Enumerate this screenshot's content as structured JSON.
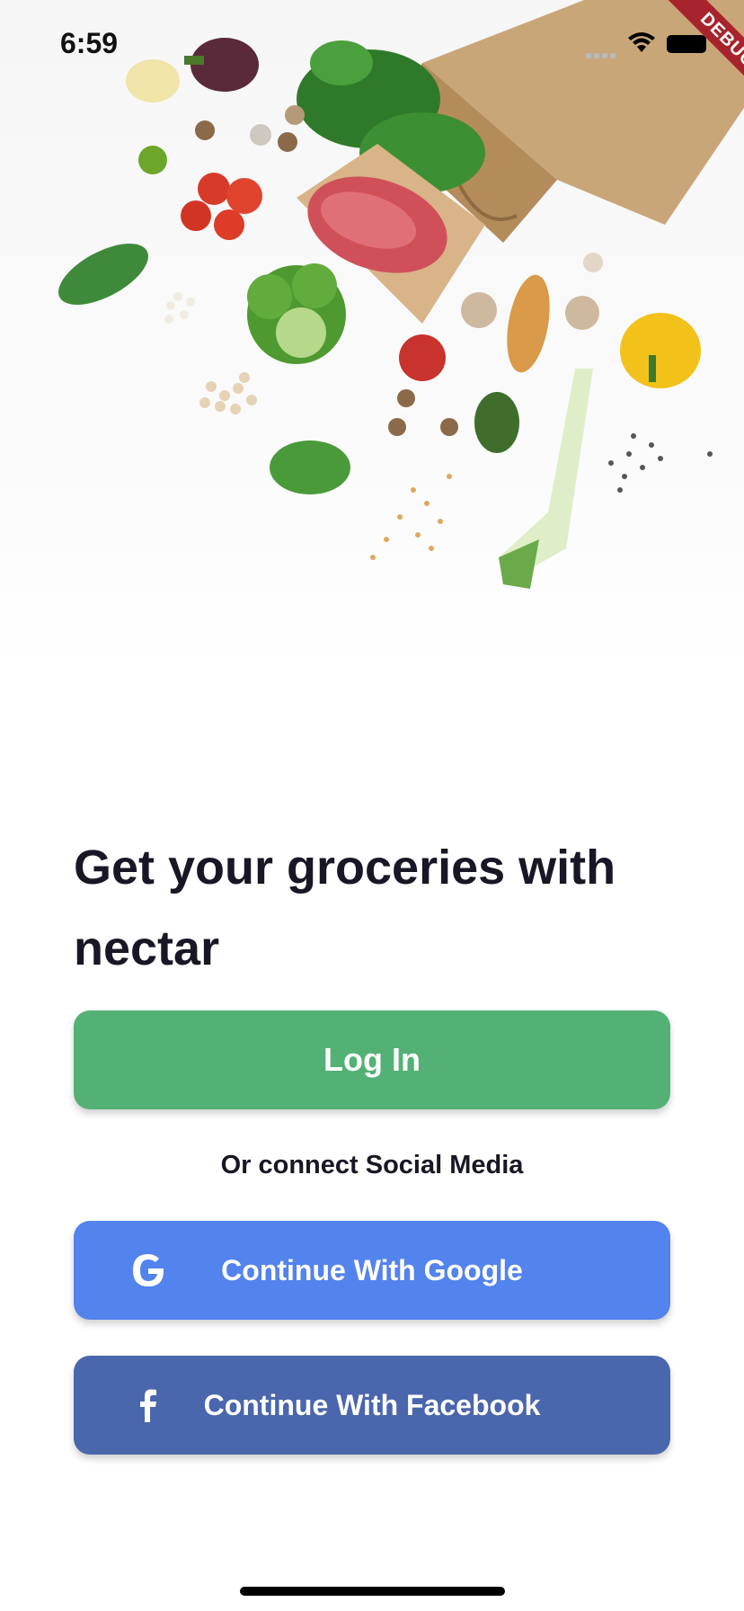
{
  "status_bar": {
    "time": "6:59",
    "debug_banner": "DEBUG"
  },
  "hero": {
    "image": "groceries-illustration"
  },
  "onboarding": {
    "headline": "Get your groceries with nectar",
    "login_button": "Log In",
    "social_prompt": "Or connect Social Media",
    "google_button": "Continue With Google",
    "facebook_button": "Continue With Facebook"
  },
  "colors": {
    "login": "#53b175",
    "google": "#5383ec",
    "facebook": "#4a66ac",
    "text": "#181725"
  },
  "icons": {
    "google": "google-icon",
    "facebook": "facebook-icon"
  }
}
